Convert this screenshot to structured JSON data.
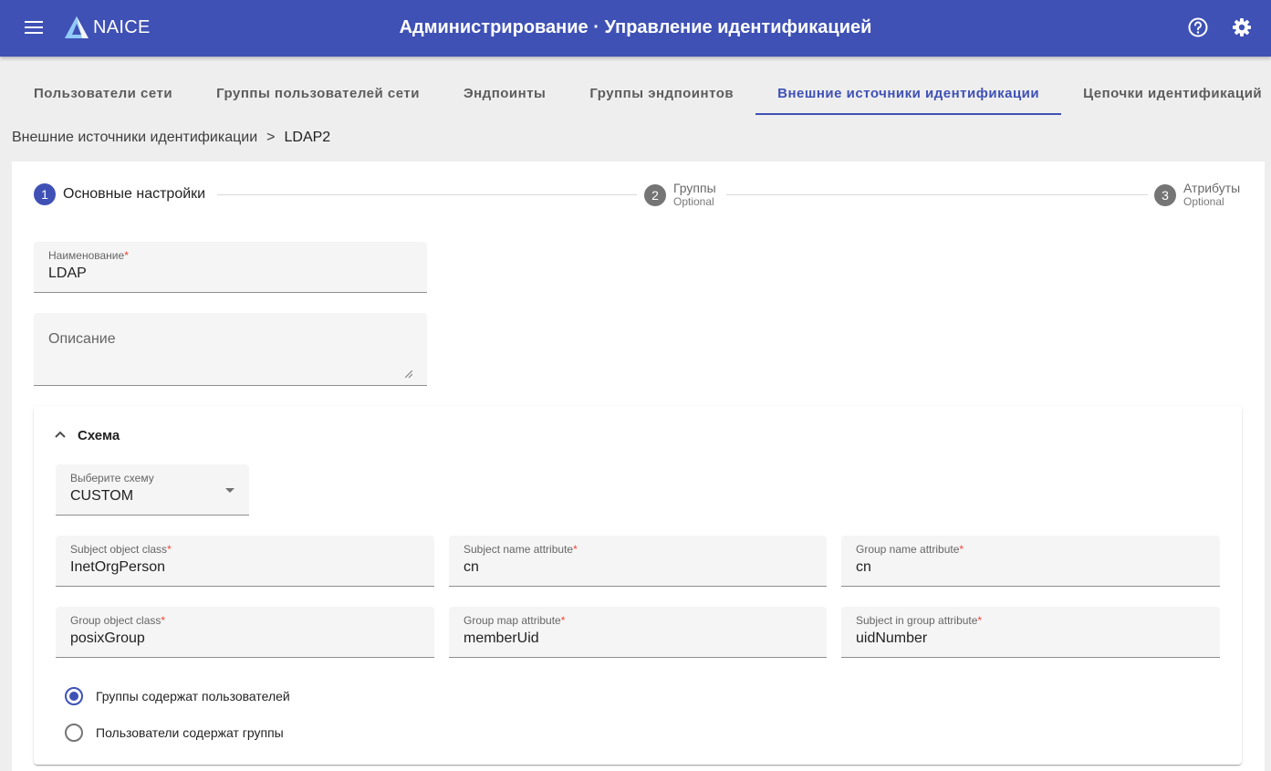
{
  "header": {
    "brand": "NAICE",
    "title": "Администрирование · Управление идентификацией",
    "menu_icon": "menu-icon",
    "help_icon": "help-circle-icon",
    "settings_icon": "gear-icon",
    "color": "#3f51b5"
  },
  "tabs": [
    {
      "label": "Пользователи сети",
      "active": false
    },
    {
      "label": "Группы пользователей сети",
      "active": false
    },
    {
      "label": "Эндпоинты",
      "active": false
    },
    {
      "label": "Группы эндпоинтов",
      "active": false
    },
    {
      "label": "Внешние источники идентификации",
      "active": true
    },
    {
      "label": "Цепочки идентификаций",
      "active": false
    }
  ],
  "breadcrumb": {
    "parent": "Внешние источники идентификации",
    "separator": ">",
    "current": "LDAP2"
  },
  "stepper": {
    "steps": [
      {
        "number": "1",
        "label": "Основные настройки",
        "optional": "",
        "active": true
      },
      {
        "number": "2",
        "label": "Группы",
        "optional": "Optional",
        "active": false
      },
      {
        "number": "3",
        "label": "Атрибуты",
        "optional": "Optional",
        "active": false
      }
    ]
  },
  "form": {
    "name": {
      "label": "Наименование",
      "required": "*",
      "value": "LDAP"
    },
    "description": {
      "placeholder": "Описание",
      "value": ""
    }
  },
  "schema_panel": {
    "title": "Схема",
    "expanded": true,
    "select": {
      "label": "Выберите схему",
      "value": "CUSTOM"
    },
    "fields": {
      "subject_object_class": {
        "label": "Subject object class",
        "required": "*",
        "value": "InetOrgPerson"
      },
      "subject_name_attribute": {
        "label": "Subject name attribute",
        "required": "*",
        "value": "cn"
      },
      "group_name_attribute": {
        "label": "Group name attribute",
        "required": "*",
        "value": "cn"
      },
      "group_object_class": {
        "label": "Group object class",
        "required": "*",
        "value": "posixGroup"
      },
      "group_map_attribute": {
        "label": "Group map attribute",
        "required": "*",
        "value": "memberUid"
      },
      "subject_in_group_attribute": {
        "label": "Subject in group attribute",
        "required": "*",
        "value": "uidNumber"
      }
    },
    "radios": [
      {
        "label": "Группы содержат пользователей",
        "checked": true
      },
      {
        "label": "Пользователи содержат группы",
        "checked": false
      }
    ]
  }
}
